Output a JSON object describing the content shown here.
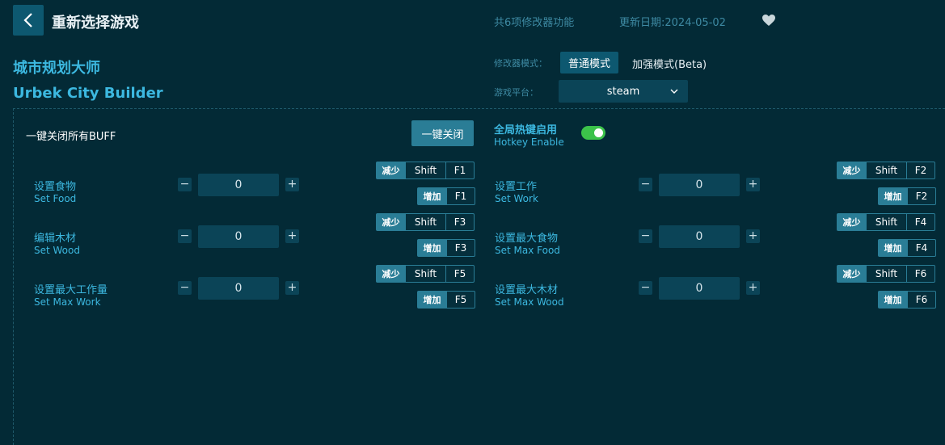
{
  "header": {
    "title": "重新选择游戏",
    "feature_count": "共6项修改器功能",
    "update_date": "更新日期:2024-05-02"
  },
  "game": {
    "name_cn": "城市规划大师",
    "name_en": "Urbek City Builder"
  },
  "mode": {
    "label": "修改器模式：",
    "normal": "普通模式",
    "enhanced": "加强模式(Beta)"
  },
  "platform": {
    "label": "游戏平台：",
    "selected": "steam"
  },
  "buff": {
    "label": "一键关闭所有BUFF",
    "button": "一键关闭"
  },
  "hotkey": {
    "label_cn": "全局热键启用",
    "label_en": "Hotkey Enable",
    "enabled": true
  },
  "labels": {
    "decrease": "减少",
    "increase": "增加",
    "shift": "Shift",
    "minus": "−",
    "plus": "+"
  },
  "options": [
    {
      "cn": "设置食物",
      "en": "Set Food",
      "value": "0",
      "dec_key": "F1",
      "inc_key": "F1"
    },
    {
      "cn": "设置工作",
      "en": "Set Work",
      "value": "0",
      "dec_key": "F2",
      "inc_key": "F2"
    },
    {
      "cn": "编辑木材",
      "en": "Set Wood",
      "value": "0",
      "dec_key": "F3",
      "inc_key": "F3"
    },
    {
      "cn": "设置最大食物",
      "en": "Set Max Food",
      "value": "0",
      "dec_key": "F4",
      "inc_key": "F4"
    },
    {
      "cn": "设置最大工作量",
      "en": "Set Max Work",
      "value": "0",
      "dec_key": "F5",
      "inc_key": "F5"
    },
    {
      "cn": "设置最大木材",
      "en": "Set Max Wood",
      "value": "0",
      "dec_key": "F6",
      "inc_key": "F6"
    }
  ],
  "colors": {
    "background": "#032a36",
    "accent": "#3cb8e0",
    "button": "#0d5870",
    "toggle_on": "#3cc24a"
  }
}
